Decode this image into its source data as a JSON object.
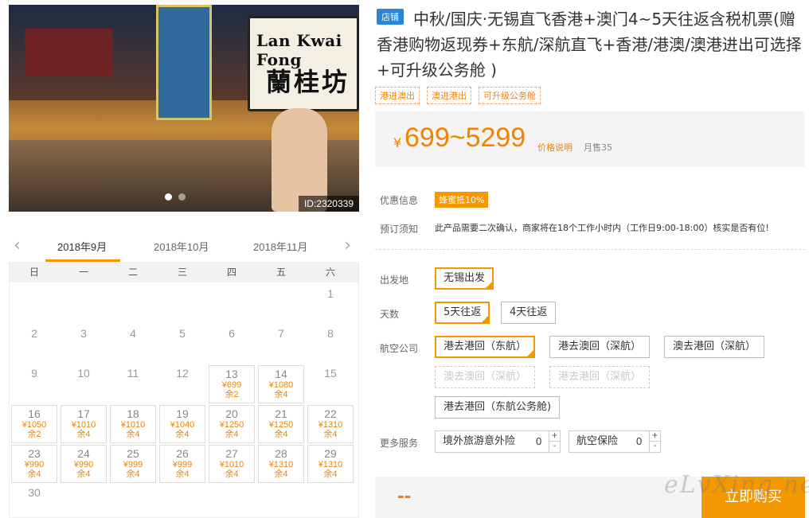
{
  "photo": {
    "sign_en": "Lan Kwai Fong",
    "sign_zh": "蘭桂坊",
    "id_tag": "ID:2320339"
  },
  "calendar": {
    "prev_icon": "chevron-left-icon",
    "next_icon": "chevron-right-icon",
    "months": [
      "2018年9月",
      "2018年10月",
      "2018年11月"
    ],
    "active_month": "2018年9月",
    "weekdays": [
      "日",
      "一",
      "二",
      "三",
      "四",
      "五",
      "六"
    ],
    "leading_blank_days": 6,
    "days": [
      {
        "d": "1"
      },
      {
        "d": "2"
      },
      {
        "d": "3"
      },
      {
        "d": "4"
      },
      {
        "d": "5"
      },
      {
        "d": "6"
      },
      {
        "d": "7"
      },
      {
        "d": "8"
      },
      {
        "d": "9"
      },
      {
        "d": "10"
      },
      {
        "d": "11"
      },
      {
        "d": "12"
      },
      {
        "d": "13",
        "p": "¥699",
        "r": "余2"
      },
      {
        "d": "14",
        "p": "¥1080",
        "r": "余4"
      },
      {
        "d": "15"
      },
      {
        "d": "16",
        "p": "¥1050",
        "r": "余2"
      },
      {
        "d": "17",
        "p": "¥1010",
        "r": "余4"
      },
      {
        "d": "18",
        "p": "¥1010",
        "r": "余4"
      },
      {
        "d": "19",
        "p": "¥1040",
        "r": "余4"
      },
      {
        "d": "20",
        "p": "¥1250",
        "r": "余4"
      },
      {
        "d": "21",
        "p": "¥1250",
        "r": "余4"
      },
      {
        "d": "22",
        "p": "¥1310",
        "r": "余4"
      },
      {
        "d": "23",
        "p": "¥990",
        "r": "余4"
      },
      {
        "d": "24",
        "p": "¥990",
        "r": "余4"
      },
      {
        "d": "25",
        "p": "¥999",
        "r": "余4"
      },
      {
        "d": "26",
        "p": "¥999",
        "r": "余4"
      },
      {
        "d": "27",
        "p": "¥1010",
        "r": "余4"
      },
      {
        "d": "28",
        "p": "¥1310",
        "r": "余4"
      },
      {
        "d": "29",
        "p": "¥1310",
        "r": "余4"
      },
      {
        "d": "30"
      }
    ]
  },
  "product": {
    "shop_tag": "店铺",
    "title": "中秋/国庆·无锡直飞香港+澳门4~5天往返含税机票(赠香港购物返现券+东航/深航直飞+香港/港澳/澳港进出可选择 +可升级公务舱 )",
    "tags": [
      "港进澳出",
      "澳进港出",
      "可升级公务舱"
    ],
    "price_currency": "¥",
    "price_range": "699~5299",
    "price_note": "价格说明",
    "monthly_sold": "月售35",
    "promo_label": "优惠信息",
    "promo_badge": "蜂蜜抵10%",
    "notice_label": "预订须知",
    "notice_text": "此产品需要二次确认，商家将在18个工作小时内（工作日9:00-18:00）核实是否有位!"
  },
  "options": {
    "departure_label": "出发地",
    "departure": "无锡出发",
    "days_label": "天数",
    "days": [
      "5天往返",
      "4天往返"
    ],
    "airline_label": "航空公司",
    "airlines": [
      "港去港回（东航）",
      "港去澳回（深航）",
      "澳去港回（深航）",
      "澳去澳回（深航）",
      "港去港回（深航）",
      "港去港回（东航公务舱)"
    ],
    "services_label": "更多服务",
    "services": [
      {
        "name": "境外旅游意外险",
        "qty": "0"
      },
      {
        "name": "航空保险",
        "qty": "0"
      }
    ],
    "stepper_plus": "+",
    "stepper_minus": "-"
  },
  "buy": {
    "total": "--",
    "button": "立即购买"
  },
  "watermark": "eLvXing.net"
}
